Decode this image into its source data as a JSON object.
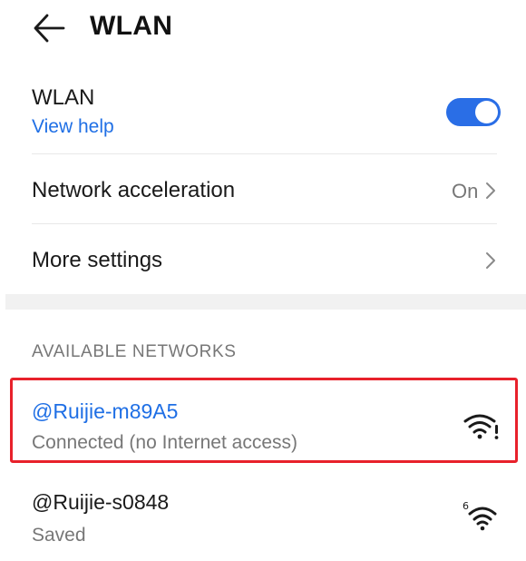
{
  "header": {
    "title": "WLAN",
    "back_icon": "arrow-left-icon"
  },
  "wlan": {
    "label": "WLAN",
    "help_link": "View help",
    "toggle_on": true,
    "accent": "#2a6ee6"
  },
  "network_acceleration": {
    "label": "Network acceleration",
    "value": "On"
  },
  "more_settings": {
    "label": "More settings"
  },
  "available": {
    "heading": "AVAILABLE NETWORKS",
    "networks": [
      {
        "name": "@Ruijie-m89A5",
        "status": "Connected (no Internet access)",
        "icon": "wifi-warning-icon",
        "name_color": "#1f6fe5"
      },
      {
        "name": "@Ruijie-s0848",
        "status": "Saved",
        "icon": "wifi-6-icon",
        "wifi_badge": "6",
        "name_color": "#1a1a1a"
      }
    ]
  }
}
